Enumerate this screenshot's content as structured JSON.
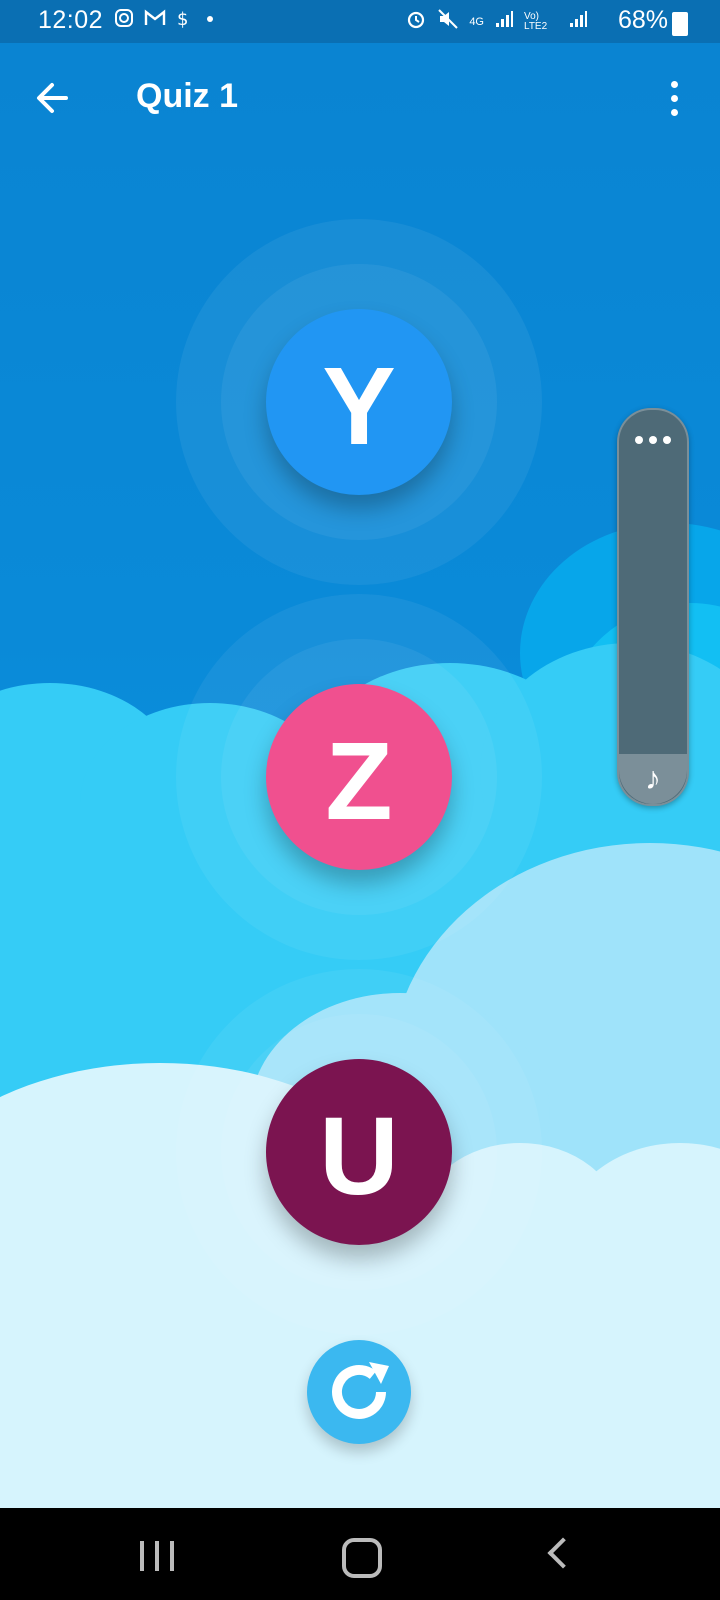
{
  "status_bar": {
    "time": "12:02",
    "left_icons": [
      "instagram-icon",
      "gmail-icon",
      "dollar-icon",
      "dot-icon"
    ],
    "right_icons": [
      "alarm-icon",
      "mute-icon",
      "4g-icon",
      "signal-icon",
      "volte-icon",
      "signal-2-icon"
    ],
    "network_4g": "4G",
    "volte": "Vo) LTE2",
    "battery": "68%"
  },
  "app_bar": {
    "title": "Quiz 1",
    "back_icon": "arrow-left-icon",
    "menu_icon": "more-vert-icon"
  },
  "letters": [
    {
      "letter": "Y",
      "color": "#2196F3"
    },
    {
      "letter": "Z",
      "color": "#F0508F"
    },
    {
      "letter": "U",
      "color": "#7B1450"
    }
  ],
  "replay_button": {
    "icon": "replay-icon",
    "color": "#3BB8F0"
  },
  "side_panel": {
    "more_icon": "more-horiz-icon",
    "music_icon": "music-note-icon",
    "music_glyph": "♪"
  },
  "nav_bar": {
    "recent_icon": "recent-apps-icon",
    "home_icon": "home-icon",
    "back_icon": "back-icon"
  }
}
